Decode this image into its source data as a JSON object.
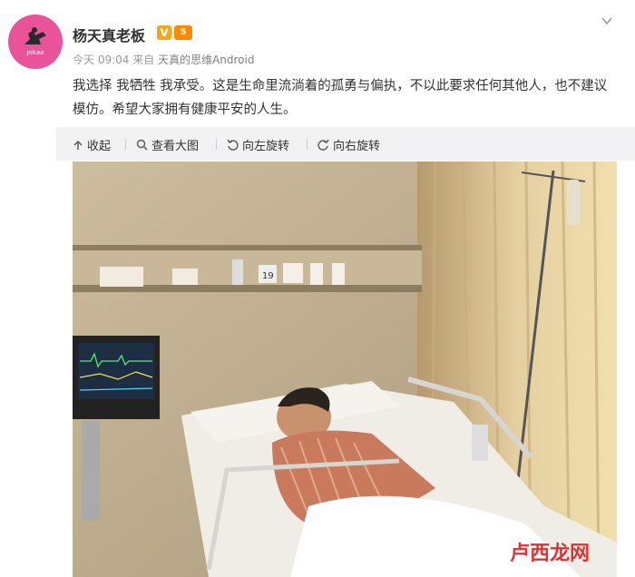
{
  "post": {
    "author": "杨天真老板",
    "avatar_text": "pikaa",
    "level_badge": "5",
    "time": "今天 09:04",
    "via_prefix": "来自",
    "source": "天真的思维Android",
    "text": "我选择 我牺牲 我承受。这是生命里流淌着的孤勇与偏执，不以此要求任何其他人，也不建议模仿。希望大家拥有健康平安的人生。"
  },
  "toolbar": {
    "collapse": "收起",
    "view_large": "查看大图",
    "rotate_left": "向左旋转",
    "rotate_right": "向右旋转"
  },
  "photo": {
    "bed_number": "19"
  },
  "watermark": "卢西龙网",
  "colors": {
    "accent": "#e8539a",
    "vip": "#f2a620",
    "level": "#ff8a00",
    "toolbar_bg": "#f2f2f5"
  },
  "icons": [
    "collapse-icon",
    "search-icon",
    "rotate-left-icon",
    "rotate-right-icon",
    "chevron-down-icon",
    "verified-v-icon"
  ]
}
